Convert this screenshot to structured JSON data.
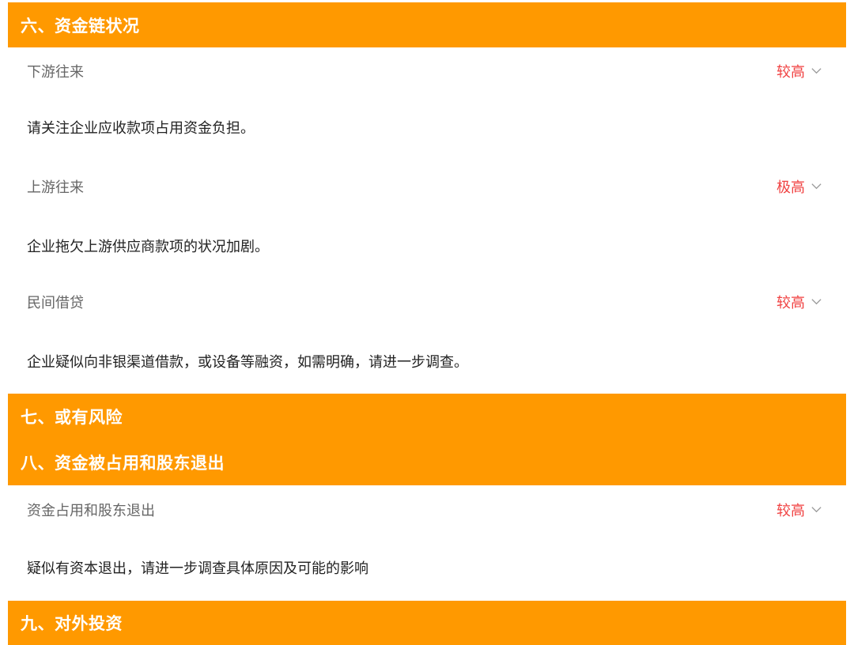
{
  "sections": [
    {
      "title": "六、资金链状况",
      "items": [
        {
          "label": "下游往来",
          "level": "较高",
          "description": "请关注企业应收款项占用资金负担。"
        },
        {
          "label": "上游往来",
          "level": "极高",
          "description": "企业拖欠上游供应商款项的状况加剧。"
        },
        {
          "label": "民间借贷",
          "level": "较高",
          "description": "企业疑似向非银渠道借款，或设备等融资，如需明确，请进一步调查。"
        }
      ]
    },
    {
      "title": "七、或有风险",
      "items": []
    },
    {
      "title": "八、资金被占用和股东退出",
      "items": [
        {
          "label": "资金占用和股东退出",
          "level": "较高",
          "description": "疑似有资本退出，请进一步调查具体原因及可能的影响"
        }
      ]
    },
    {
      "title": "九、对外投资",
      "items": []
    }
  ],
  "colors": {
    "header_bg": "#ff9900",
    "header_text": "#ffffff",
    "level_text": "#f04141",
    "label_text": "#666666",
    "description_text": "#222222"
  },
  "icons": {
    "expand": "chevron-down-icon"
  }
}
